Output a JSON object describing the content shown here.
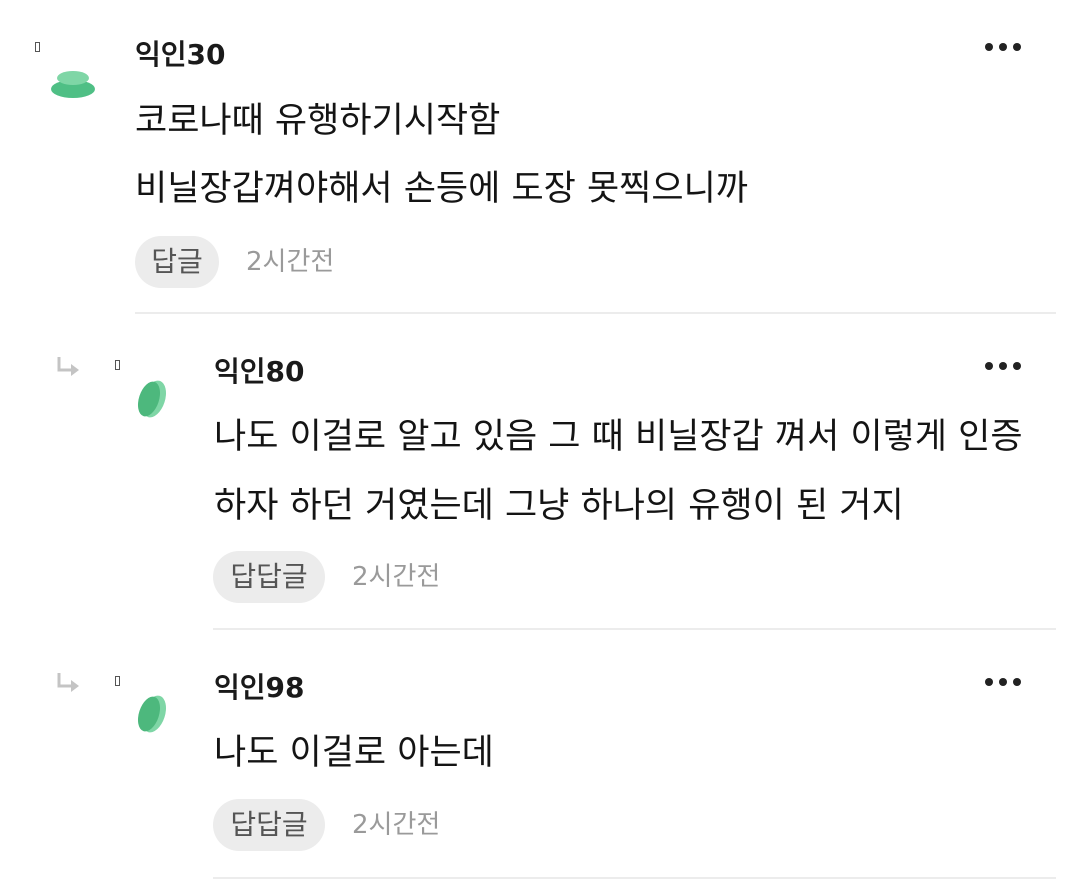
{
  "comments": [
    {
      "nickname": "익인30",
      "lines": [
        "코로나때 유행하기시작함",
        "비닐장갑껴야해서 손등에 도장 못찍으니까"
      ],
      "reply_label": "답글",
      "time": "2시간전",
      "avatar_color": "#5ec48c",
      "is_reply": false
    },
    {
      "nickname": "익인80",
      "lines": [
        "나도 이걸로 알고 있음 그 때 비닐장갑 껴서 이렇게 인증",
        "하자 하던 거였는데 그냥 하나의 유행이 된 거지"
      ],
      "reply_label": "답답글",
      "time": "2시간전",
      "avatar_color": "#4db87d",
      "is_reply": true
    },
    {
      "nickname": "익인98",
      "lines": [
        "나도 이걸로 아는데"
      ],
      "reply_label": "답답글",
      "time": "2시간전",
      "avatar_color": "#4db87d",
      "is_reply": true
    }
  ],
  "icons": {
    "more": "more-options-icon",
    "reply_arrow": "reply-arrow-icon",
    "avatar": "avatar-icon"
  },
  "colors": {
    "reply_button_bg": "#ececec",
    "timestamp": "#9a9a9a",
    "divider": "#ececec"
  }
}
